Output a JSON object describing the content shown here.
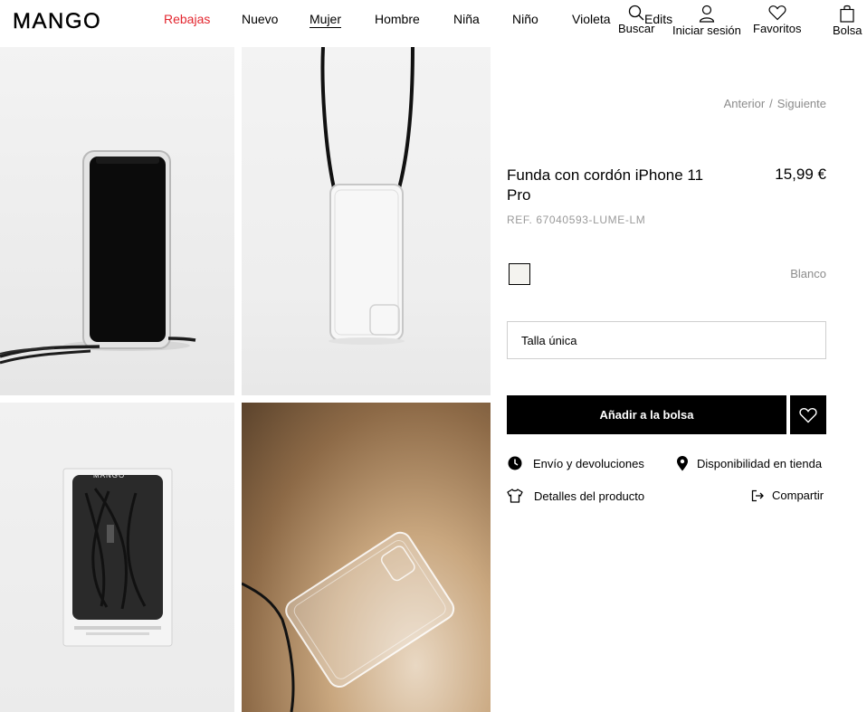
{
  "brand": {
    "logo_text": "MANGO"
  },
  "nav": {
    "items": [
      {
        "label": "Rebajas"
      },
      {
        "label": "Nuevo"
      },
      {
        "label": "Mujer"
      },
      {
        "label": "Hombre"
      },
      {
        "label": "Niña"
      },
      {
        "label": "Niño"
      },
      {
        "label": "Violeta"
      },
      {
        "label": "Edits"
      }
    ]
  },
  "utility": {
    "search_label": "Buscar",
    "login_label": "Iniciar sesión",
    "favorites_label": "Favoritos",
    "bag_label": "Bolsa"
  },
  "pagination": {
    "previous": "Anterior",
    "separator": "/",
    "next": "Siguiente"
  },
  "product": {
    "name": "Funda con cordón iPhone 11 Pro",
    "price": "15,99 €",
    "reference": "REF. 67040593-LUME-LM",
    "color_name": "Blanco",
    "swatch_color": "#f4f3ef",
    "size": "Talla única"
  },
  "actions": {
    "add_to_bag": "Añadir a la bolsa",
    "shipping": "Envío y devoluciones",
    "store_availability": "Disponibilidad en tienda",
    "details": "Detalles del producto",
    "share": "Compartir"
  },
  "colors": {
    "sale": "#e3262f",
    "primary": "#000000",
    "muted": "#8c8c8c"
  },
  "icons": [
    "search-icon",
    "user-icon",
    "heart-icon",
    "bag-icon",
    "clock-icon",
    "location-pin-icon",
    "tshirt-icon",
    "share-icon"
  ]
}
